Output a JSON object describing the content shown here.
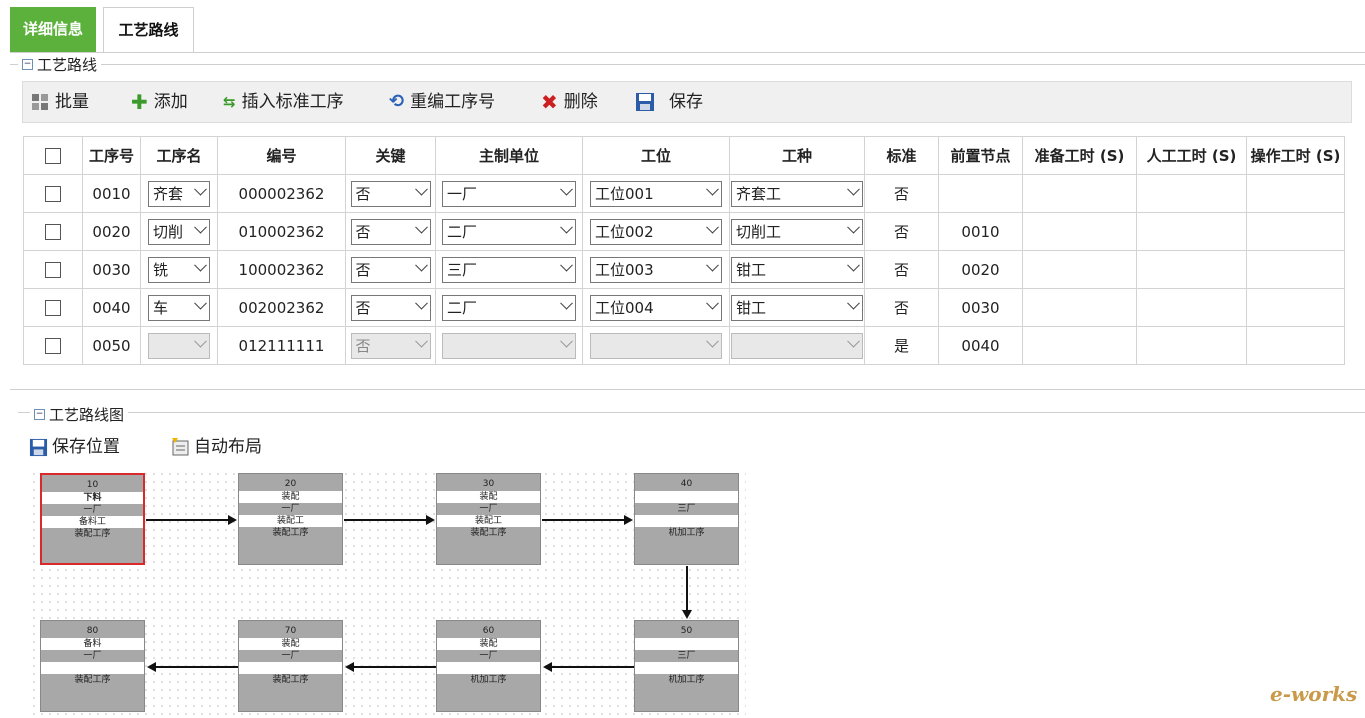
{
  "tabs": [
    {
      "label": "详细信息",
      "active": true
    },
    {
      "label": "工艺路线",
      "active": false
    }
  ],
  "route_section": {
    "title": "工艺路线"
  },
  "toolbar": {
    "batch": "批量",
    "add": "添加",
    "insert_std": "插入标准工序",
    "renumber": "重编工序号",
    "delete": "删除",
    "save": "保存"
  },
  "table": {
    "headers": [
      "工序号",
      "工序名",
      "编号",
      "关键",
      "主制单位",
      "工位",
      "工种",
      "标准",
      "前置节点",
      "准备工时 (S)",
      "人工工时 (S)",
      "操作工时 (S)"
    ],
    "rows": [
      {
        "seq": "0010",
        "name": "齐套",
        "code": "000002362",
        "key": "否",
        "unit": "一厂",
        "station": "工位001",
        "trade": "齐套工",
        "std": "否",
        "prev": "",
        "disabled": false
      },
      {
        "seq": "0020",
        "name": "切削",
        "code": "010002362",
        "key": "否",
        "unit": "二厂",
        "station": "工位002",
        "trade": "切削工",
        "std": "否",
        "prev": "0010",
        "disabled": false
      },
      {
        "seq": "0030",
        "name": "铣",
        "code": "100002362",
        "key": "否",
        "unit": "三厂",
        "station": "工位003",
        "trade": "钳工",
        "std": "否",
        "prev": "0020",
        "disabled": false
      },
      {
        "seq": "0040",
        "name": "车",
        "code": "002002362",
        "key": "否",
        "unit": "二厂",
        "station": "工位004",
        "trade": "钳工",
        "std": "否",
        "prev": "0030",
        "disabled": false
      },
      {
        "seq": "0050",
        "name": "",
        "code": "012111111",
        "key": "否",
        "unit": "",
        "station": "",
        "trade": "",
        "std": "是",
        "prev": "0040",
        "disabled": true
      }
    ]
  },
  "diagram_section": {
    "title": "工艺路线图",
    "save_pos": "保存位置",
    "auto_layout": "自动布局"
  },
  "nodes": [
    {
      "id": "10",
      "rows": [
        "下料",
        "一厂",
        "备料工",
        "装配工序"
      ]
    },
    {
      "id": "20",
      "rows": [
        "装配",
        "一厂",
        "装配工",
        "装配工序"
      ]
    },
    {
      "id": "30",
      "rows": [
        "装配",
        "一厂",
        "装配工",
        "装配工序"
      ]
    },
    {
      "id": "40",
      "rows": [
        "",
        "三厂",
        "",
        "机加工序"
      ]
    },
    {
      "id": "80",
      "rows": [
        "备料",
        "一厂",
        "",
        "装配工序"
      ]
    },
    {
      "id": "70",
      "rows": [
        "装配",
        "一厂",
        "",
        "装配工序"
      ]
    },
    {
      "id": "60",
      "rows": [
        "装配",
        "一厂",
        "",
        "机加工序"
      ]
    },
    {
      "id": "50",
      "rows": [
        "",
        "三厂",
        "",
        "机加工序"
      ]
    }
  ],
  "watermark": "e-works",
  "colors": {
    "accent": "#5cb13c",
    "selected_node": "#d9292a",
    "delete": "#cc1f1f",
    "add": "#3a9a2a"
  }
}
